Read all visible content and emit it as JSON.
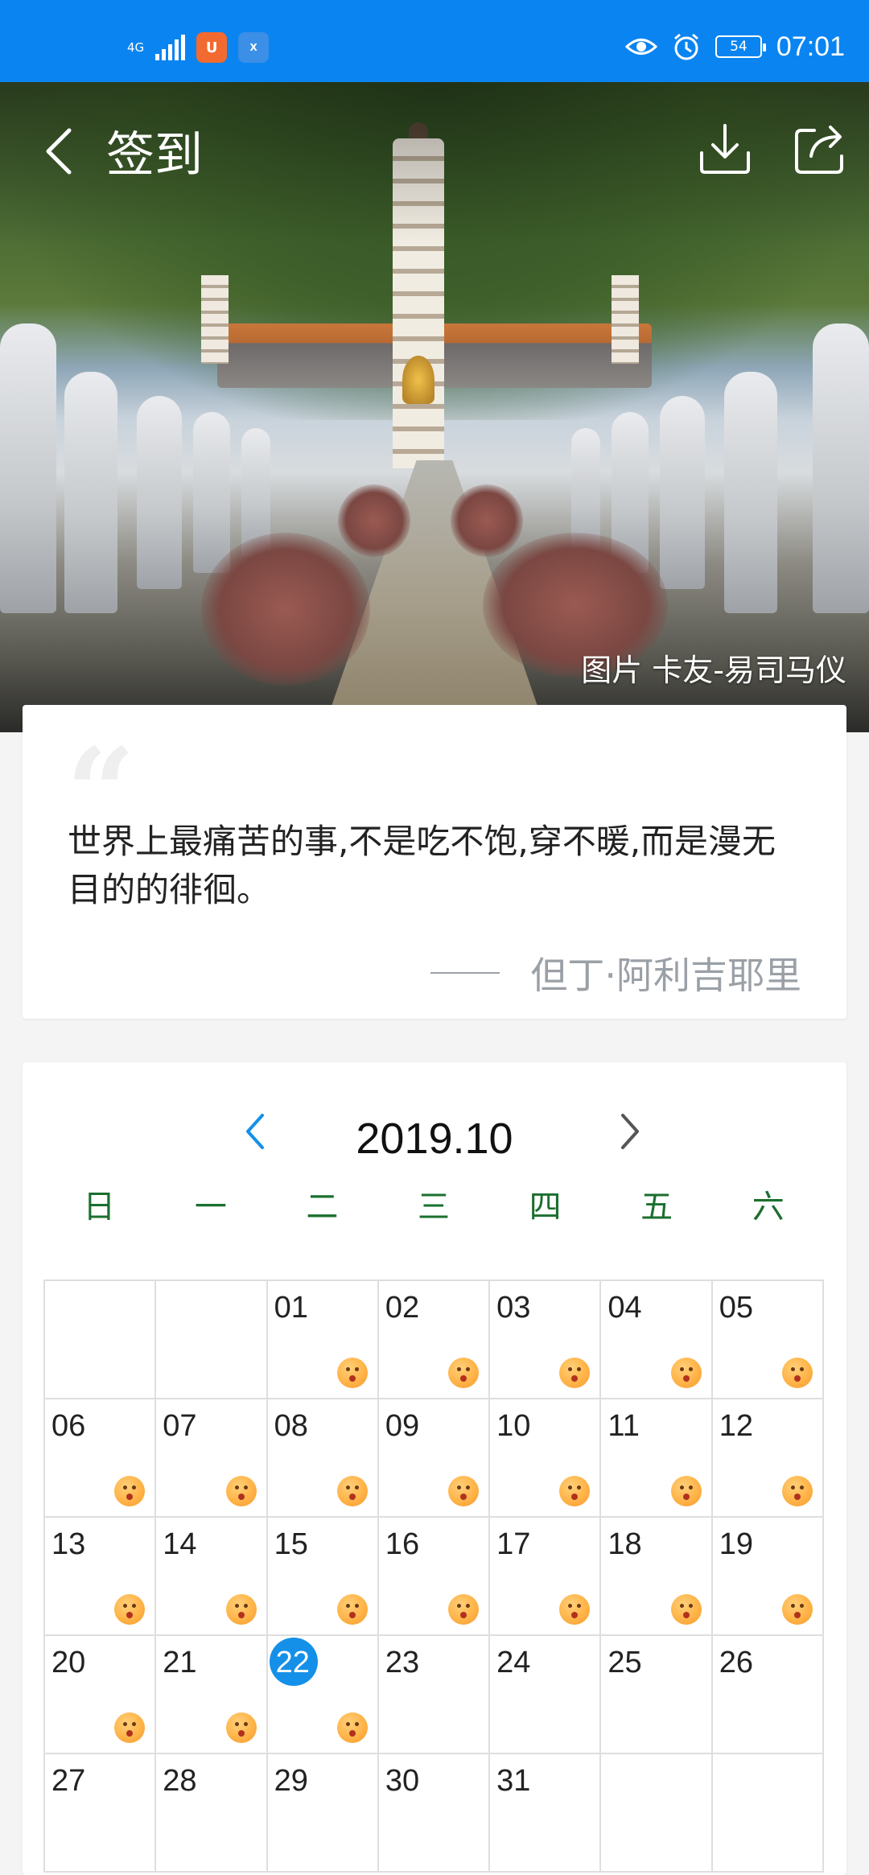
{
  "status_bar": {
    "network": "4G",
    "battery": "54",
    "time": "07:01",
    "icons": [
      "signal-icon",
      "uc-browser-icon",
      "xiaoying-icon",
      "eye-comfort-icon",
      "alarm-icon",
      "battery-icon"
    ]
  },
  "header": {
    "title": "签到",
    "photo_credit": "图片 卡友-易司马仪"
  },
  "quote": {
    "text": "世界上最痛苦的事,不是吃不饱,穿不暖,而是漫无目的的徘徊。",
    "author": "但丁·阿利吉耶里"
  },
  "calendar": {
    "month": "2019.10",
    "weekdays": [
      "日",
      "一",
      "二",
      "三",
      "四",
      "五",
      "六"
    ],
    "today": "22",
    "emoji_color": "#ffb347",
    "today_color": "#1590e8",
    "weeks": [
      [
        {
          "day": "",
          "signed": false
        },
        {
          "day": "",
          "signed": false
        },
        {
          "day": "01",
          "signed": true
        },
        {
          "day": "02",
          "signed": true
        },
        {
          "day": "03",
          "signed": true
        },
        {
          "day": "04",
          "signed": true
        },
        {
          "day": "05",
          "signed": true
        }
      ],
      [
        {
          "day": "06",
          "signed": true
        },
        {
          "day": "07",
          "signed": true
        },
        {
          "day": "08",
          "signed": true
        },
        {
          "day": "09",
          "signed": true
        },
        {
          "day": "10",
          "signed": true
        },
        {
          "day": "11",
          "signed": true
        },
        {
          "day": "12",
          "signed": true
        }
      ],
      [
        {
          "day": "13",
          "signed": true
        },
        {
          "day": "14",
          "signed": true
        },
        {
          "day": "15",
          "signed": true
        },
        {
          "day": "16",
          "signed": true
        },
        {
          "day": "17",
          "signed": true
        },
        {
          "day": "18",
          "signed": true
        },
        {
          "day": "19",
          "signed": true
        }
      ],
      [
        {
          "day": "20",
          "signed": true
        },
        {
          "day": "21",
          "signed": true
        },
        {
          "day": "22",
          "signed": true
        },
        {
          "day": "23",
          "signed": false
        },
        {
          "day": "24",
          "signed": false
        },
        {
          "day": "25",
          "signed": false
        },
        {
          "day": "26",
          "signed": false
        }
      ],
      [
        {
          "day": "27",
          "signed": false
        },
        {
          "day": "28",
          "signed": false
        },
        {
          "day": "29",
          "signed": false
        },
        {
          "day": "30",
          "signed": false
        },
        {
          "day": "31",
          "signed": false
        },
        {
          "day": "",
          "signed": false
        },
        {
          "day": "",
          "signed": false
        }
      ]
    ]
  }
}
